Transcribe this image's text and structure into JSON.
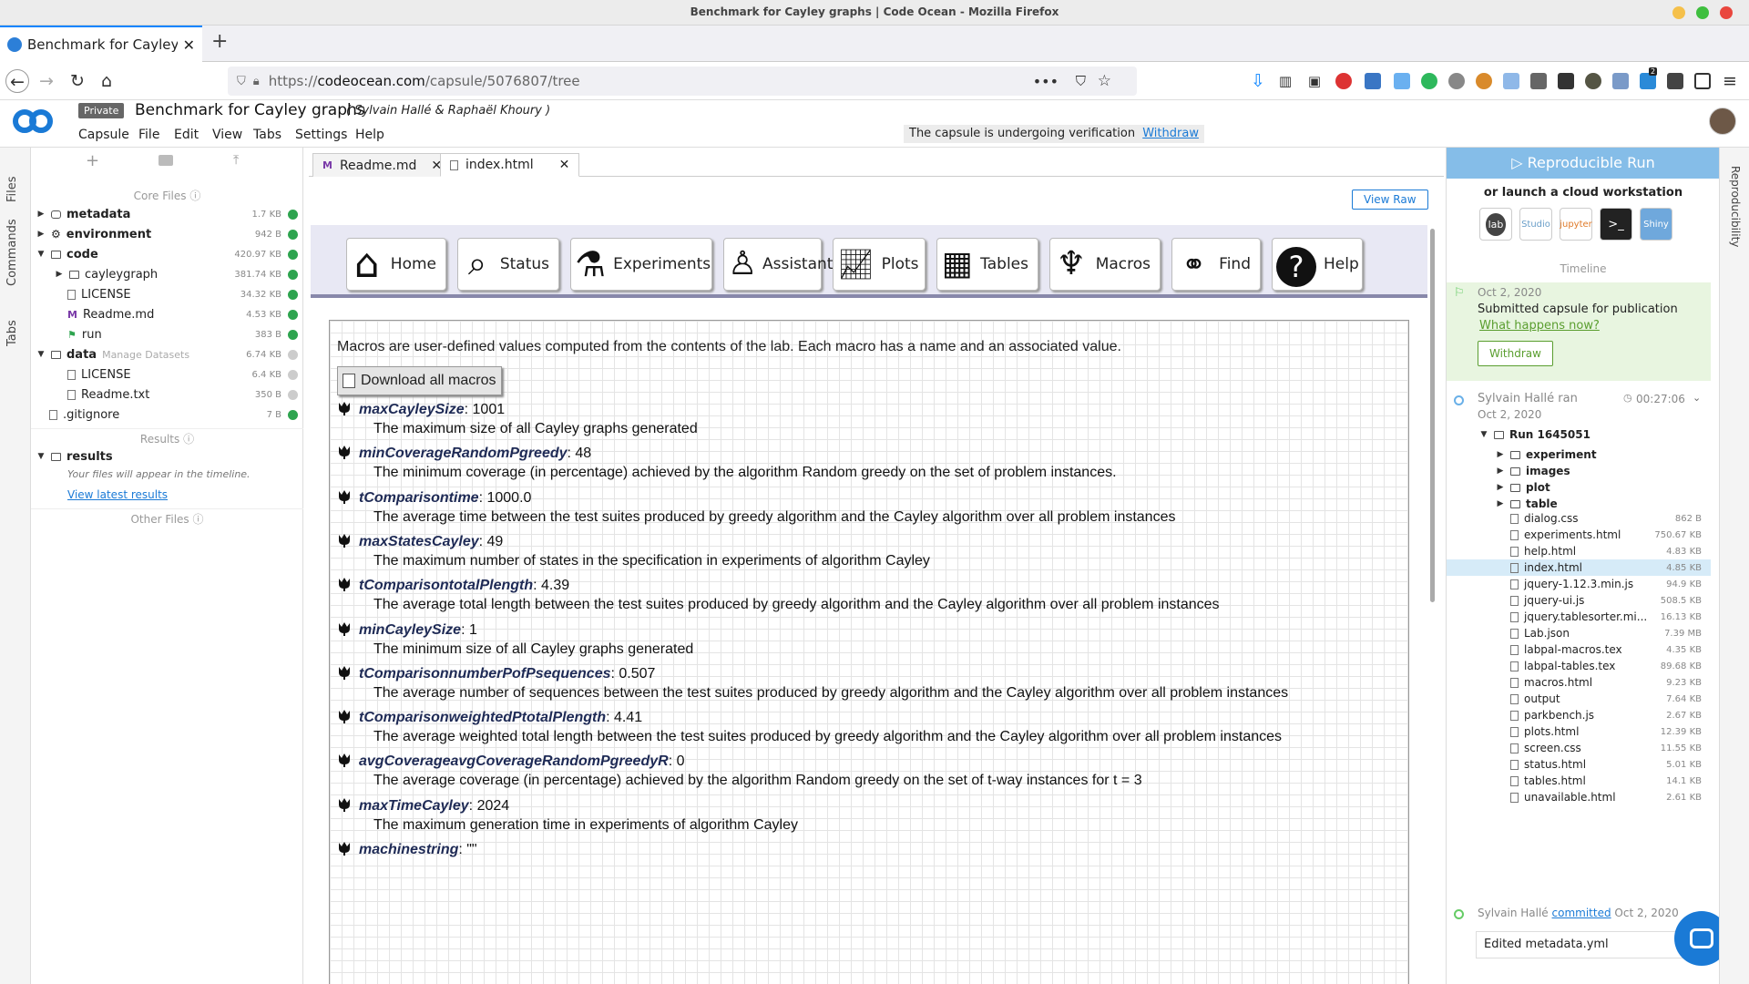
{
  "window": {
    "title": "Benchmark for Cayley graphs | Code Ocean - Mozilla Firefox"
  },
  "browser": {
    "tab_title": "Benchmark for Cayley g",
    "url_prefix": "https://",
    "url_domain": "codeocean.com",
    "url_path": "/capsule/5076807/tree",
    "ext_badge": "2"
  },
  "app": {
    "private_badge": "Private",
    "capsule_title": "Benchmark for Cayley graphs",
    "authors": "( Sylvain Hallé & Raphaël Khoury )",
    "menu": [
      "Capsule",
      "File",
      "Edit",
      "View",
      "Tabs",
      "Settings",
      "Help"
    ],
    "verification_text": "The capsule is undergoing verification",
    "withdraw_link": "Withdraw"
  },
  "left_tabs": [
    "Files",
    "Commands",
    "Tabs"
  ],
  "files": {
    "core_label": "Core Files",
    "results_label": "Results",
    "other_label": "Other Files",
    "core": [
      {
        "name": "metadata",
        "size": "1.7 KB"
      },
      {
        "name": "environment",
        "size": "942 B"
      },
      {
        "name": "code",
        "size": "420.97 KB"
      },
      {
        "name": "cayleygraph",
        "size": "381.74 KB"
      },
      {
        "name": "LICENSE",
        "size": "34.32 KB"
      },
      {
        "name": "Readme.md",
        "size": "4.53 KB"
      },
      {
        "name": "run",
        "size": "383 B"
      },
      {
        "name": "data",
        "size": "6.74 KB",
        "extra": "Manage Datasets"
      },
      {
        "name": "LICENSE",
        "size": "6.4 KB"
      },
      {
        "name": "Readme.txt",
        "size": "350 B"
      },
      {
        "name": ".gitignore",
        "size": "7 B"
      }
    ],
    "results_folder": "results",
    "results_note": "Your files will appear in the timeline.",
    "view_latest": "View latest results"
  },
  "editor": {
    "tabs": [
      "Readme.md",
      "index.html"
    ],
    "view_raw": "View Raw"
  },
  "lab_nav": [
    "Home",
    "Status",
    "Experiments",
    "Assistant",
    "Plots",
    "Tables",
    "Macros",
    "Find",
    "Help"
  ],
  "macros": {
    "intro": "Macros are user-defined values computed from the contents of the lab. Each macro has a name and an associated value.",
    "download_button": "Download all macros",
    "items": [
      {
        "name": "maxCayleySize",
        "value": ": 1001",
        "desc": "The maximum size of all Cayley graphs generated"
      },
      {
        "name": "minCoverageRandomPgreedy",
        "value": ": 48",
        "desc": "The minimum coverage (in percentage) achieved by the algorithm Random greedy on the set of problem instances."
      },
      {
        "name": "tComparisontime",
        "value": ": 1000.0",
        "desc": "The average time between the test suites produced by greedy algorithm and the Cayley algorithm over all problem instances"
      },
      {
        "name": "maxStatesCayley",
        "value": ": 49",
        "desc": "The maximum number of states in the specification in experiments of algorithm Cayley"
      },
      {
        "name": "tComparisontotalPlength",
        "value": ": 4.39",
        "desc": "The average total length between the test suites produced by greedy algorithm and the Cayley algorithm over all problem instances"
      },
      {
        "name": "minCayleySize",
        "value": ": 1",
        "desc": "The minimum size of all Cayley graphs generated"
      },
      {
        "name": "tComparisonnumberPofPsequences",
        "value": ": 0.507",
        "desc": "The average number of sequences between the test suites produced by greedy algorithm and the Cayley algorithm over all problem instances"
      },
      {
        "name": "tComparisonweightedPtotalPlength",
        "value": ": 4.41",
        "desc": "The average weighted total length between the test suites produced by greedy algorithm and the Cayley algorithm over all problem instances"
      },
      {
        "name": "avgCoverageavgCoverageRandomPgreedyR",
        "value": ": 0",
        "desc": "The average coverage (in percentage) achieved by the algorithm Random greedy on the set of t-way instances for t = 3"
      },
      {
        "name": "maxTimeCayley",
        "value": ": 2024",
        "desc": "The maximum generation time in experiments of algorithm Cayley"
      },
      {
        "name": "machinestring",
        "value": ": \"\"",
        "desc": ""
      }
    ]
  },
  "right": {
    "run_button": "Reproducible Run",
    "launch_text": "or launch a cloud workstation",
    "workstations": [
      "lab",
      "Studio",
      "jupyter",
      "terminal",
      "Shiny"
    ],
    "timeline_label": "Timeline",
    "event1": {
      "date": "Oct 2, 2020",
      "text": "Submitted capsule for publication",
      "link": "What happens now?",
      "button": "Withdraw"
    },
    "event2": {
      "who": "Sylvain Hallé ran",
      "date": "Oct 2, 2020",
      "duration": "00:27:06",
      "run": "Run 1645051",
      "folders": [
        "experiment",
        "images",
        "plot",
        "table"
      ],
      "files": [
        {
          "name": "dialog.css",
          "size": "862 B"
        },
        {
          "name": "experiments.html",
          "size": "750.67 KB"
        },
        {
          "name": "help.html",
          "size": "4.83 KB"
        },
        {
          "name": "index.html",
          "size": "4.85 KB"
        },
        {
          "name": "jquery-1.12.3.min.js",
          "size": "94.9 KB"
        },
        {
          "name": "jquery-ui.js",
          "size": "508.5 KB"
        },
        {
          "name": "jquery.tablesorter.mi...",
          "size": "16.13 KB"
        },
        {
          "name": "Lab.json",
          "size": "7.39 MB"
        },
        {
          "name": "labpal-macros.tex",
          "size": "4.35 KB"
        },
        {
          "name": "labpal-tables.tex",
          "size": "89.68 KB"
        },
        {
          "name": "macros.html",
          "size": "9.23 KB"
        },
        {
          "name": "output",
          "size": "7.64 KB"
        },
        {
          "name": "parkbench.js",
          "size": "2.67 KB"
        },
        {
          "name": "plots.html",
          "size": "12.39 KB"
        },
        {
          "name": "screen.css",
          "size": "11.55 KB"
        },
        {
          "name": "status.html",
          "size": "5.01 KB"
        },
        {
          "name": "tables.html",
          "size": "14.1 KB"
        },
        {
          "name": "unavailable.html",
          "size": "2.61 KB"
        }
      ]
    },
    "event3": {
      "who": "Sylvain Hallé",
      "link": "committed",
      "date": "Oct 2, 2020",
      "message": "Edited metadata.yml"
    },
    "strip_label": "Reproducibility"
  }
}
